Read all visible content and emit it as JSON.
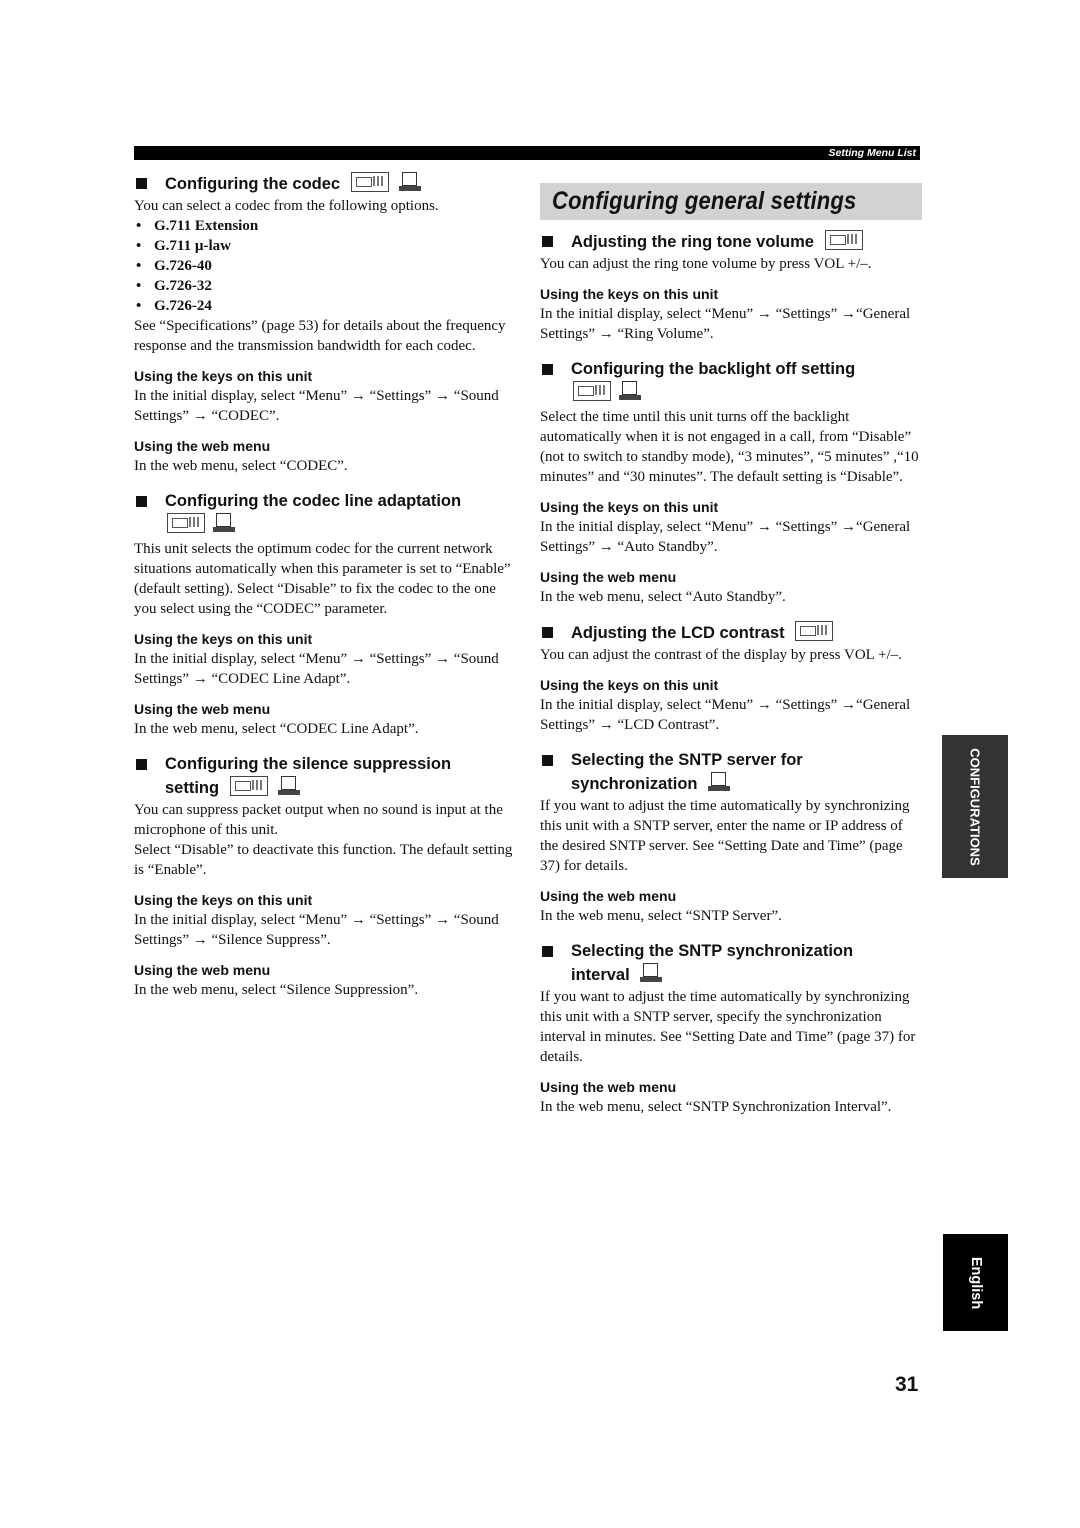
{
  "header": {
    "running_title": "Setting Menu List"
  },
  "left": {
    "codec": {
      "title": "Configuring the codec",
      "intro": "You can select a codec from the following options.",
      "options": [
        "G.711 Extension",
        "G.711 µ-law",
        "G.726-40",
        "G.726-32",
        "G.726-24"
      ],
      "note": "See “Specifications” (page 53) for details about the frequency response and the transmission bandwidth for each codec.",
      "keys_heading": "Using the keys on this unit",
      "keys_text": "In the initial display, select “Menu” → “Settings” → “Sound Settings” → “CODEC”.",
      "web_heading": "Using the web menu",
      "web_text": "In the web menu, select “CODEC”."
    },
    "line_adapt": {
      "title": "Configuring the codec line adaptation",
      "body": "This unit selects the optimum codec for the current network situations automatically when this parameter is set to “Enable” (default setting). Select “Disable” to fix the codec to the one you select using the “CODEC” parameter.",
      "keys_heading": "Using the keys on this unit",
      "keys_text": "In the initial display, select “Menu” → “Settings” → “Sound Settings” → “CODEC Line Adapt”.",
      "web_heading": "Using the web menu",
      "web_text": "In the web menu, select “CODEC Line Adapt”."
    },
    "silence": {
      "title_line1": "Configuring the silence suppression",
      "title_line2": "setting",
      "body1": "You can suppress packet output when no sound is input at the microphone of this unit.",
      "body2": "Select “Disable” to deactivate this function. The default setting is “Enable”.",
      "keys_heading": "Using the keys on this unit",
      "keys_text": "In the initial display, select “Menu” → “Settings” → “Sound Settings” → “Silence Suppress”.",
      "web_heading": "Using the web menu",
      "web_text": "In the web menu, select “Silence Suppression”."
    }
  },
  "right": {
    "section_title": "Configuring general settings",
    "ring": {
      "title": "Adjusting the ring tone volume",
      "body": "You can adjust the ring tone volume by press VOL +/–.",
      "keys_heading": "Using the keys on this unit",
      "keys_text": "In the initial display, select “Menu” → “Settings” →“General Settings” → “Ring Volume”."
    },
    "backlight": {
      "title": "Configuring the backlight off setting",
      "body": "Select the time until this unit turns off the backlight automatically when it is not engaged in a call, from “Disable” (not to switch to standby mode), “3 minutes”, “5 minutes” ,“10 minutes” and “30 minutes”. The default setting is “Disable”.",
      "keys_heading": "Using the keys on this unit",
      "keys_text": "In the initial display, select “Menu” → “Settings” →“General Settings” → “Auto Standby”.",
      "web_heading": "Using the web menu",
      "web_text": "In the web menu, select “Auto Standby”."
    },
    "lcd": {
      "title": "Adjusting the LCD contrast",
      "body": "You can adjust the contrast of the display by press VOL +/–.",
      "keys_heading": "Using the keys on this unit",
      "keys_text": "In the initial display, select “Menu” → “Settings” →“General Settings” → “LCD Contrast”."
    },
    "sntp_server": {
      "title_line1": "Selecting the SNTP server for",
      "title_line2": "synchronization",
      "body": "If you want to adjust the time automatically by synchronizing this unit with a SNTP server, enter the name or IP address of the desired SNTP server. See “Setting Date and Time” (page 37) for details.",
      "web_heading": "Using the web menu",
      "web_text": "In the web menu, select “SNTP Server”."
    },
    "sntp_interval": {
      "title_line1": "Selecting the SNTP synchronization",
      "title_line2": "interval",
      "body": "If you want to adjust the time automatically by synchronizing this unit with a SNTP server, specify the synchronization interval in minutes. See “Setting Date and Time” (page 37) for details.",
      "web_heading": "Using the web menu",
      "web_text": "In the web menu, select “SNTP Synchronization Interval”."
    }
  },
  "side_tabs": {
    "chapter": "CONFIGURATIONS",
    "language": "English"
  },
  "footer": {
    "page_number": "31"
  }
}
